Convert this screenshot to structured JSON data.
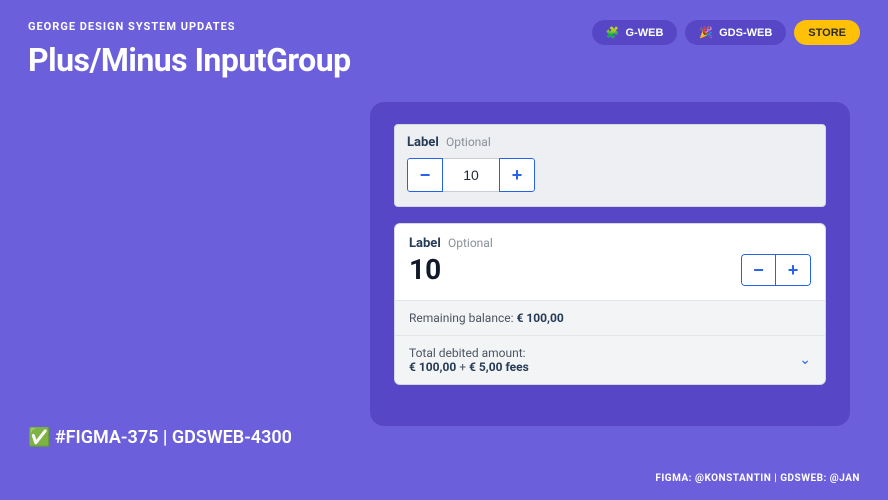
{
  "header": {
    "subtitle": "GEORGE DESIGN SYSTEM UPDATES",
    "title": "Plus/Minus InputGroup",
    "pills": {
      "gweb": "G-WEB",
      "gds": "GDS-WEB",
      "store": "STORE"
    }
  },
  "demo1": {
    "label": "Label",
    "optional": "Optional",
    "value": "10"
  },
  "demo2": {
    "label": "Label",
    "optional": "Optional",
    "value": "10",
    "balance_label": "Remaining balance:",
    "balance_value": "€ 100,00",
    "debit_label": "Total debited amount:",
    "debit_line1": "€ 100,00",
    "debit_plus": " + ",
    "debit_line2": "€ 5,00 fees"
  },
  "footer": {
    "check": "✅",
    "tag": "#FIGMA-375 | GDSWEB-4300",
    "credits": "FIGMA: @KONSTANTIN | GDSWEB: @JAN"
  },
  "icons": {
    "figma": "🧩",
    "sparkle": "🎉"
  }
}
